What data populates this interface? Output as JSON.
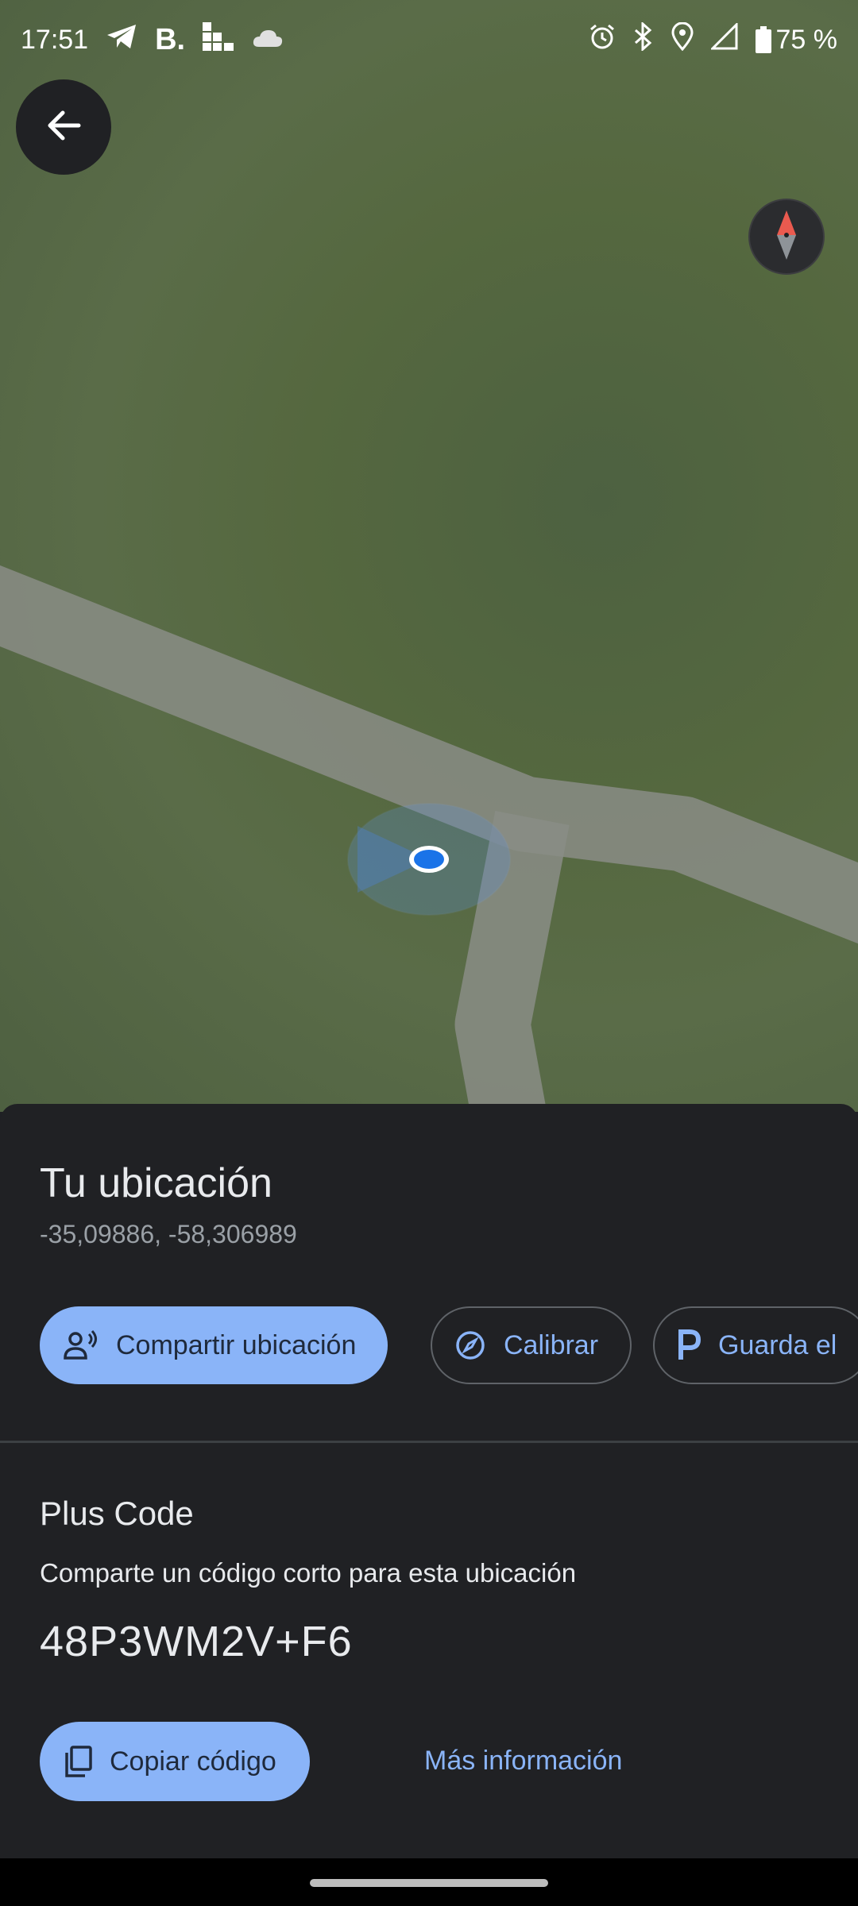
{
  "status_bar": {
    "time": "17:51",
    "left_icons": [
      "telegram-icon",
      "booking-icon",
      "app-grid-icon",
      "cloud-icon"
    ],
    "booking_letter": "B.",
    "right_icons": [
      "alarm-icon",
      "bluetooth-icon",
      "location-icon",
      "signal-icon",
      "battery-icon"
    ],
    "battery_text": "75 %"
  },
  "map": {
    "icons": [
      "back-arrow-icon",
      "compass-icon",
      "current-location-dot-icon"
    ],
    "colors": {
      "terrain": "#55683f",
      "road": "#8a8d86",
      "location_dot": "#1a73e8"
    }
  },
  "sheet": {
    "title": "Tu ubicación",
    "coordinates": "-35,09886, -58,306989",
    "chips": [
      {
        "label": "Compartir ubicación",
        "icon": "share-location-icon"
      },
      {
        "label": "Calibrar",
        "icon": "compass-calibrate-icon"
      },
      {
        "label": "Guarda el",
        "icon": "parking-icon"
      }
    ],
    "plus_code": {
      "heading": "Plus Code",
      "description": "Comparte un código corto para esta ubicación",
      "code": "48P3WM2V+F6",
      "copy_label": "Copiar código",
      "copy_icon": "copy-icon",
      "more_info_label": "Más información"
    }
  },
  "colors": {
    "accent": "#8ab4f8",
    "sheet_bg": "#202124",
    "secondary_text": "#9aa0a6"
  }
}
